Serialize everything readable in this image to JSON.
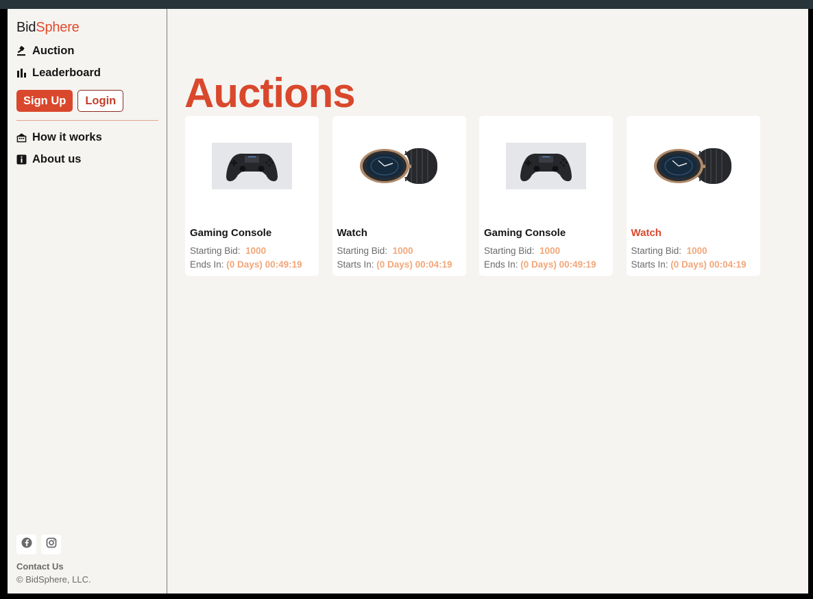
{
  "brand": {
    "name_part1": "Bid",
    "name_part2": "Sphere",
    "accent_color": "#e04a2a"
  },
  "sidebar": {
    "nav_top": [
      {
        "label": "Auction",
        "icon": "gavel-icon"
      },
      {
        "label": "Leaderboard",
        "icon": "bar-chart-icon"
      }
    ],
    "signup_label": "Sign Up",
    "login_label": "Login",
    "nav_bottom": [
      {
        "label": "How it works",
        "icon": "building-icon"
      },
      {
        "label": "About us",
        "icon": "info-icon"
      }
    ],
    "footer": {
      "socials": [
        "facebook-icon",
        "instagram-icon"
      ],
      "contact_label": "Contact Us",
      "copyright": "© BidSphere, LLC."
    }
  },
  "main": {
    "title": "Auctions",
    "cards": [
      {
        "name": "Gaming Console",
        "image": "gamepad-image",
        "bid_label": "Starting Bid:",
        "bid_value": "1000",
        "time_label": "Ends In:",
        "time_value": "(0 Days) 00:49:19",
        "highlight": false
      },
      {
        "name": "Watch",
        "image": "watch-image",
        "bid_label": "Starting Bid:",
        "bid_value": "1000",
        "time_label": "Starts In:",
        "time_value": "(0 Days) 00:04:19",
        "highlight": false
      },
      {
        "name": "Gaming Console",
        "image": "gamepad-image",
        "bid_label": "Starting Bid:",
        "bid_value": "1000",
        "time_label": "Ends In:",
        "time_value": "(0 Days) 00:49:19",
        "highlight": false
      },
      {
        "name": "Watch",
        "image": "watch-image",
        "bid_label": "Starting Bid:",
        "bid_value": "1000",
        "time_label": "Starts In:",
        "time_value": "(0 Days) 00:04:19",
        "highlight": true
      }
    ]
  },
  "colors": {
    "primary": "#d9482c",
    "value_text": "#f2a679",
    "background": "#f5f4f1"
  }
}
